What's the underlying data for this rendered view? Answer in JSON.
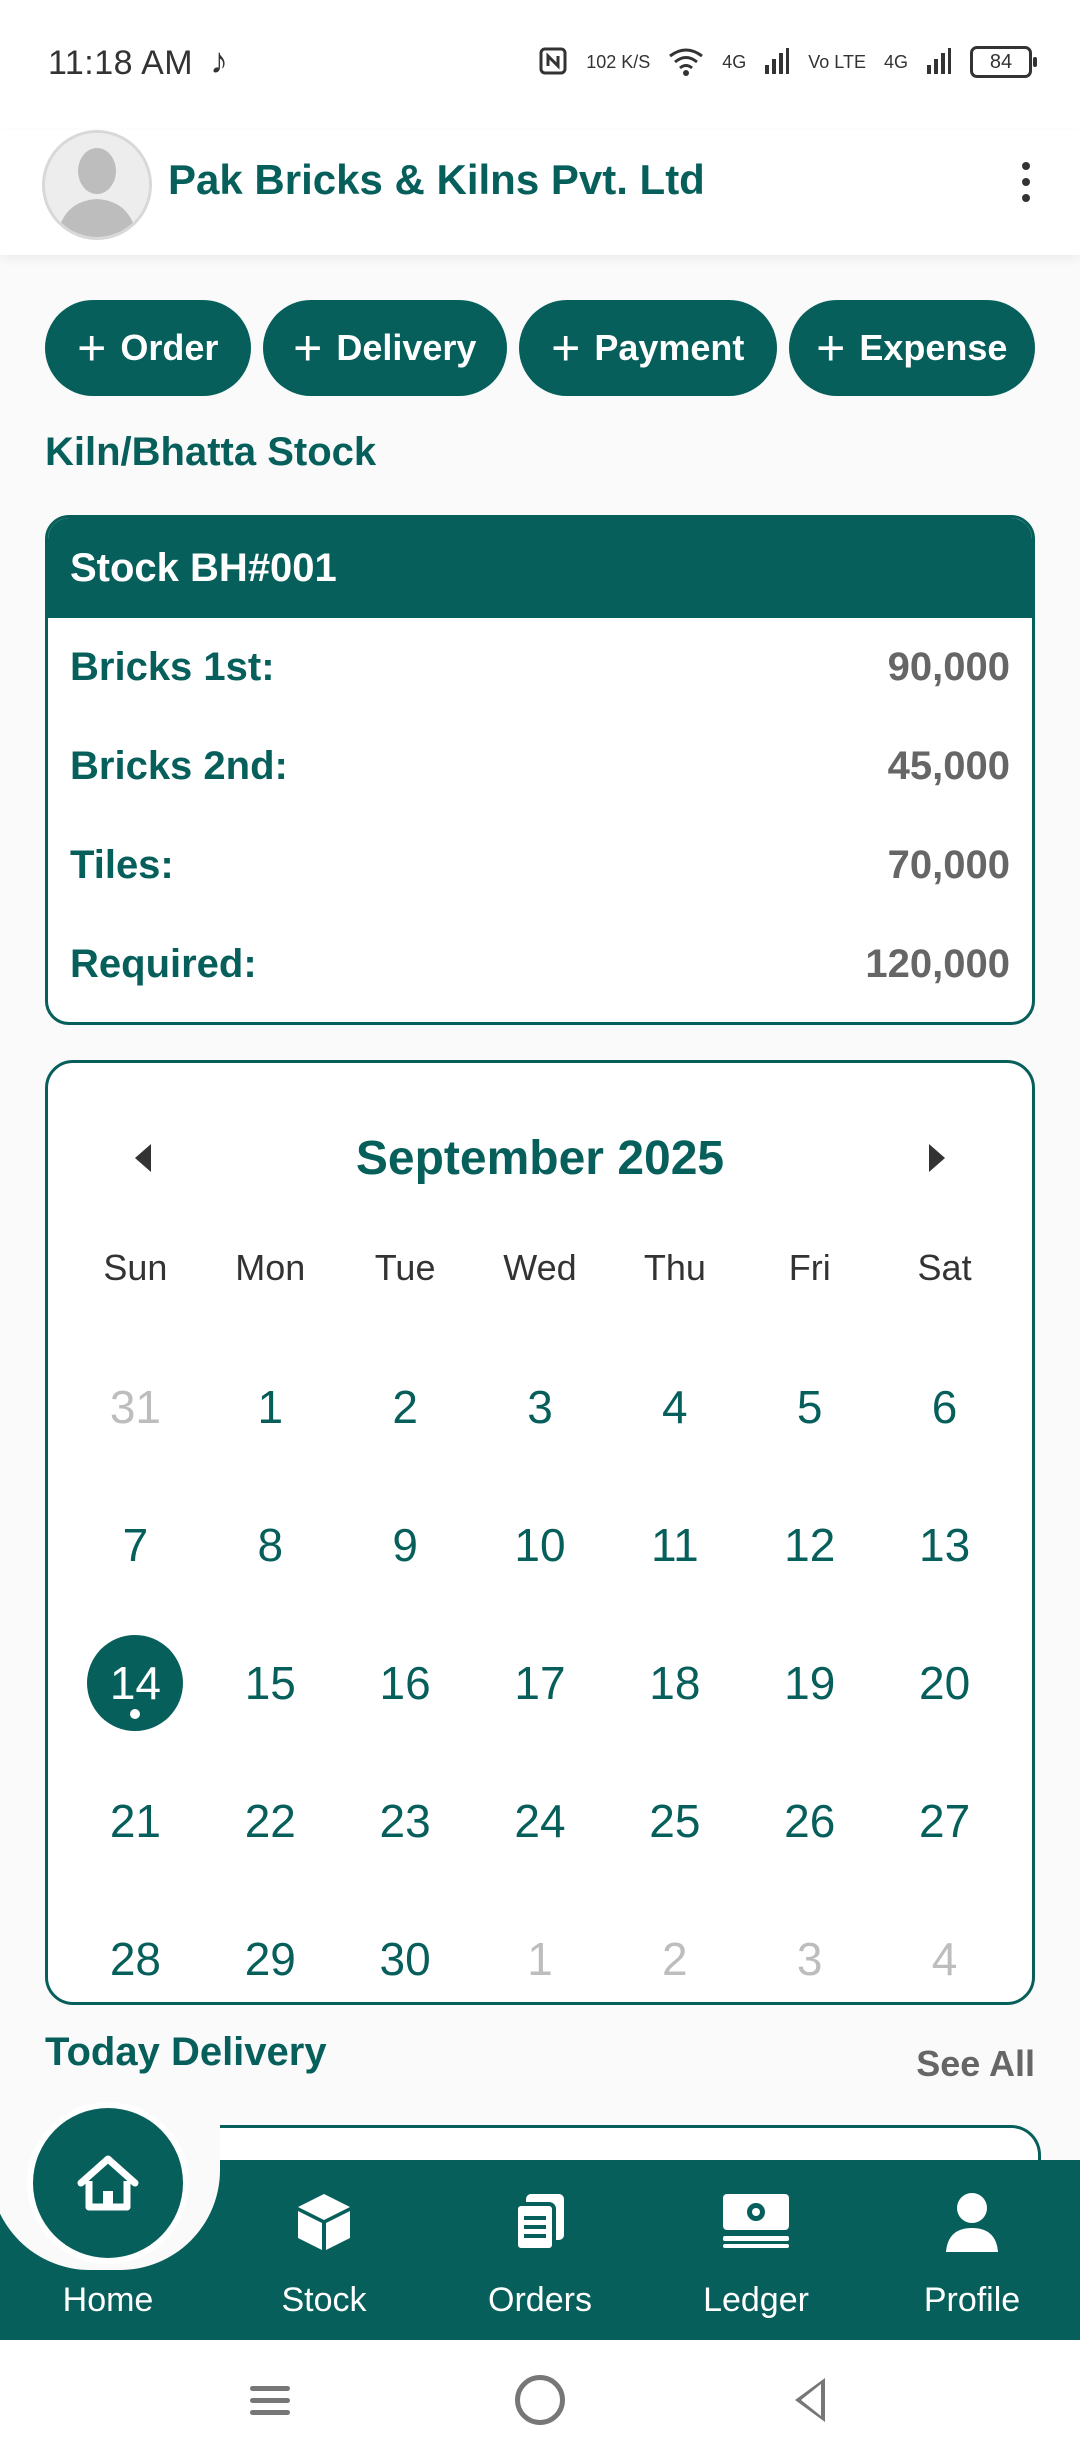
{
  "status_bar": {
    "time": "11:18 AM",
    "net_speed": "102 K/S",
    "network_1": "4G",
    "volte": "Vo LTE",
    "network_2": "4G",
    "battery": "84"
  },
  "header": {
    "title": "Pak Bricks & Kilns Pvt. Ltd"
  },
  "actions": [
    {
      "label": "Order"
    },
    {
      "label": "Delivery"
    },
    {
      "label": "Payment"
    },
    {
      "label": "Expense"
    }
  ],
  "stock_section": {
    "title": "Kiln/Bhatta Stock",
    "card_title": "Stock BH#001",
    "rows": [
      {
        "label": "Bricks 1st:",
        "value": "90,000"
      },
      {
        "label": "Bricks 2nd:",
        "value": "45,000"
      },
      {
        "label": "Tiles:",
        "value": "70,000"
      },
      {
        "label": "Required:",
        "value": "120,000"
      }
    ]
  },
  "calendar": {
    "month_title": "September 2025",
    "weekdays": [
      "Sun",
      "Mon",
      "Tue",
      "Wed",
      "Thu",
      "Fri",
      "Sat"
    ],
    "days": [
      {
        "d": "31",
        "muted": true
      },
      {
        "d": "1"
      },
      {
        "d": "2"
      },
      {
        "d": "3"
      },
      {
        "d": "4"
      },
      {
        "d": "5"
      },
      {
        "d": "6"
      },
      {
        "d": "7"
      },
      {
        "d": "8"
      },
      {
        "d": "9"
      },
      {
        "d": "10"
      },
      {
        "d": "11"
      },
      {
        "d": "12"
      },
      {
        "d": "13"
      },
      {
        "d": "14",
        "today": true
      },
      {
        "d": "15"
      },
      {
        "d": "16"
      },
      {
        "d": "17"
      },
      {
        "d": "18"
      },
      {
        "d": "19"
      },
      {
        "d": "20"
      },
      {
        "d": "21"
      },
      {
        "d": "22"
      },
      {
        "d": "23"
      },
      {
        "d": "24"
      },
      {
        "d": "25"
      },
      {
        "d": "26"
      },
      {
        "d": "27"
      },
      {
        "d": "28"
      },
      {
        "d": "29"
      },
      {
        "d": "30"
      },
      {
        "d": "1",
        "muted": true
      },
      {
        "d": "2",
        "muted": true
      },
      {
        "d": "3",
        "muted": true
      },
      {
        "d": "4",
        "muted": true
      }
    ]
  },
  "today_delivery": {
    "title": "Today Delivery",
    "see_all": "See All"
  },
  "bottom_nav": [
    {
      "label": "Home",
      "icon": "home-icon",
      "active": true
    },
    {
      "label": "Stock",
      "icon": "box-icon"
    },
    {
      "label": "Orders",
      "icon": "orders-icon"
    },
    {
      "label": "Ledger",
      "icon": "money-icon"
    },
    {
      "label": "Profile",
      "icon": "user-icon"
    }
  ],
  "colors": {
    "primary": "#075F5B",
    "muted_text": "#666666",
    "muted_day": "#BDBDBD"
  }
}
